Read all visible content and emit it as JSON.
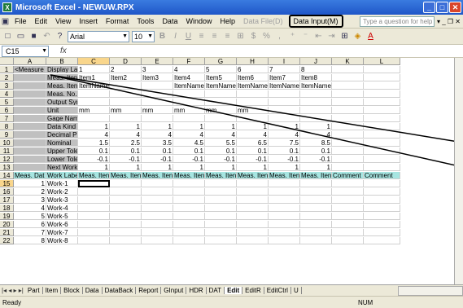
{
  "window": {
    "title": "Microsoft Excel - NEWUW.RPX",
    "app_icon": "X",
    "min": "_",
    "max": "□",
    "close": "✕"
  },
  "menu": {
    "items": [
      "File",
      "Edit",
      "View",
      "Insert",
      "Format",
      "Tools",
      "Data",
      "Window",
      "Help"
    ],
    "disabled": "Data File(D)",
    "highlighted": "Data Input(M)",
    "help_placeholder": "Type a question for help",
    "doc_controls": "▾ _ ❐ ✕"
  },
  "toolbar": {
    "font": "Arial",
    "size": "10",
    "bold": "B",
    "italic": "I",
    "underline": "U"
  },
  "formula_bar": {
    "cell_ref": "C15",
    "fx": "fx"
  },
  "columns": [
    "A",
    "B",
    "C",
    "D",
    "E",
    "F",
    "G",
    "H",
    "I",
    "J",
    "K",
    "L"
  ],
  "rows": [
    [
      "1",
      "<Measure",
      "Display La",
      "1",
      "2",
      "3",
      "4",
      "5",
      "6",
      "7",
      "8",
      "",
      ""
    ],
    [
      "2",
      "",
      "Meas. Iten",
      "Item1",
      "Item2",
      "Item3",
      "Item4",
      "Item5",
      "Item6",
      "Item7",
      "Item8",
      "",
      ""
    ],
    [
      "3",
      "",
      "Meas. Iten",
      "ItemName",
      "",
      "",
      "ItemName",
      "ItemName",
      "ItemName",
      "ItemName",
      "ItemName8",
      "",
      ""
    ],
    [
      "4",
      "",
      "Meas. No.",
      "",
      "",
      "",
      "",
      "",
      "",
      "",
      "",
      "",
      ""
    ],
    [
      "5",
      "",
      "Output Symbol",
      "",
      "",
      "",
      "",
      "",
      "",
      "",
      "",
      "",
      ""
    ],
    [
      "6",
      "",
      "Unit",
      "mm",
      "mm",
      "mm",
      "mm",
      "mm",
      "mm",
      "",
      "",
      "",
      ""
    ],
    [
      "7",
      "",
      "Gage Name",
      "",
      "",
      "",
      "",
      "",
      "",
      "",
      "",
      "",
      ""
    ],
    [
      "8",
      "",
      "Data Kind",
      "1",
      "1",
      "1",
      "1",
      "1",
      "1",
      "1",
      "1",
      "",
      ""
    ],
    [
      "9",
      "",
      "Decimal P",
      "4",
      "4",
      "4",
      "4",
      "4",
      "4",
      "4",
      "4",
      "",
      ""
    ],
    [
      "10",
      "",
      "Nominal",
      "1.5",
      "2.5",
      "3.5",
      "4.5",
      "5.5",
      "6.5",
      "7.5",
      "8.5",
      "",
      ""
    ],
    [
      "11",
      "",
      "Upper Tole",
      "0.1",
      "0.1",
      "0.1",
      "0.1",
      "0.1",
      "0.1",
      "0.1",
      "0.1",
      "",
      ""
    ],
    [
      "12",
      "",
      "Lower Tole",
      "-0.1",
      "-0.1",
      "-0.1",
      "-0.1",
      "-0.1",
      "-0.1",
      "-0.1",
      "-0.1",
      "",
      ""
    ],
    [
      "13",
      "",
      "Next Work",
      "1",
      "1",
      "1",
      "1",
      "1",
      "1",
      "1",
      "1",
      "",
      ""
    ],
    [
      "14",
      "Meas. Dat",
      "Work Labe",
      "Meas. Iten",
      "Meas. Iten",
      "Meas. Iten",
      "Meas. Iten",
      "Meas. Iten",
      "Meas. Iten",
      "Meas. Iten",
      "Meas. Iten",
      "Comment",
      "Comment"
    ],
    [
      "15",
      "1",
      "Work-1",
      "",
      "",
      "",
      "",
      "",
      "",
      "",
      "",
      "",
      ""
    ],
    [
      "16",
      "2",
      "Work-2",
      "",
      "",
      "",
      "",
      "",
      "",
      "",
      "",
      "",
      ""
    ],
    [
      "17",
      "3",
      "Work-3",
      "",
      "",
      "",
      "",
      "",
      "",
      "",
      "",
      "",
      ""
    ],
    [
      "18",
      "4",
      "Work-4",
      "",
      "",
      "",
      "",
      "",
      "",
      "",
      "",
      "",
      ""
    ],
    [
      "19",
      "5",
      "Work-5",
      "",
      "",
      "",
      "",
      "",
      "",
      "",
      "",
      "",
      ""
    ],
    [
      "20",
      "6",
      "Work-6",
      "",
      "",
      "",
      "",
      "",
      "",
      "",
      "",
      "",
      ""
    ],
    [
      "21",
      "7",
      "Work-7",
      "",
      "",
      "",
      "",
      "",
      "",
      "",
      "",
      "",
      ""
    ],
    [
      "22",
      "8",
      "Work-8",
      "",
      "",
      "",
      "",
      "",
      "",
      "",
      "",
      "",
      ""
    ]
  ],
  "sheet_tabs": [
    "Part",
    "Item",
    "Block",
    "Data",
    "DataBack",
    "Report",
    "GInput",
    "HDR",
    "DAT",
    "Edit",
    "EditR",
    "EditCtrl",
    "U"
  ],
  "active_tab": "Edit",
  "tab_nav": "|◂ ◂ ▸ ▸|",
  "status": {
    "left": "Ready",
    "num": "NUM"
  }
}
